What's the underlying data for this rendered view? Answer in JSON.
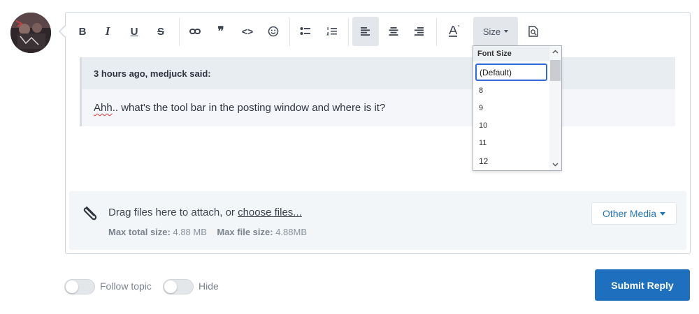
{
  "toolbar": {
    "bold": "B",
    "italic": "I",
    "underline": "U",
    "strike": "S",
    "quote_glyph": "❞",
    "code_glyph": "<>",
    "size_label": "Size"
  },
  "quote": {
    "header": "3 hours ago, medjuck said:",
    "first_word": "Ahh",
    "rest": ".. what's the tool bar in the posting window and where is it?"
  },
  "font_size_dropdown": {
    "header": "Font Size",
    "default_option": "(Default)",
    "options": [
      "8",
      "9",
      "10",
      "11",
      "12"
    ]
  },
  "attachments": {
    "drag_text": "Drag files here to attach, or ",
    "choose_link": "choose files...",
    "max_total_label": "Max total size:",
    "max_total_value": "4.88 MB",
    "max_file_label": "Max file size:",
    "max_file_value": "4.88MB",
    "other_media": "Other Media"
  },
  "footer": {
    "follow_topic": "Follow topic",
    "hide": "Hide",
    "submit": "Submit Reply"
  },
  "colors": {
    "accent": "#1e6fbd",
    "link": "#2577b1",
    "active_toolbar_bg": "#e3e7ec"
  }
}
